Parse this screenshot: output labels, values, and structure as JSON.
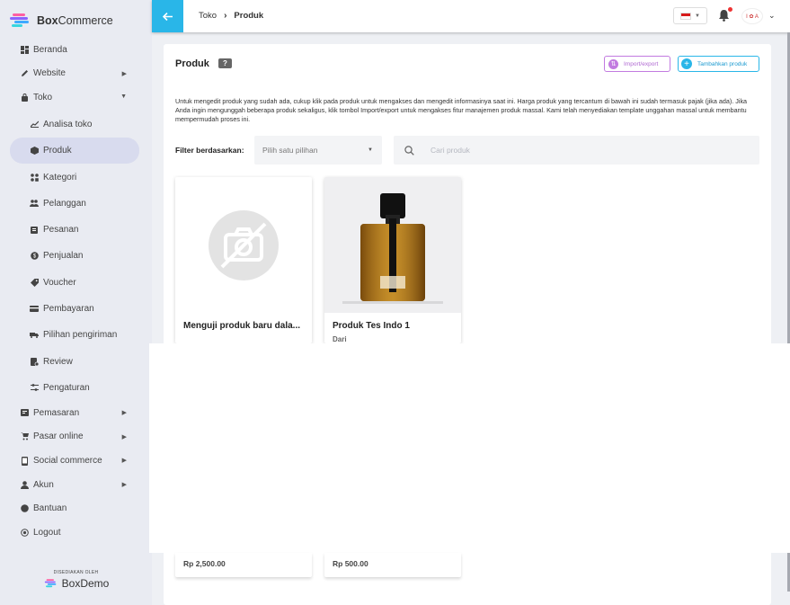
{
  "brand": {
    "name_bold": "Box",
    "name_rest": "Commerce"
  },
  "sidebar": {
    "items": [
      {
        "label": "Beranda",
        "icon": "dashboard-icon"
      },
      {
        "label": "Website",
        "icon": "pencil-icon",
        "expandable": true
      },
      {
        "label": "Toko",
        "icon": "bag-icon",
        "expanded": true
      }
    ],
    "sub_items": [
      {
        "label": "Analisa toko",
        "icon": "chart-icon"
      },
      {
        "label": "Produk",
        "icon": "box-icon",
        "active": true
      },
      {
        "label": "Kategori",
        "icon": "category-icon"
      },
      {
        "label": "Pelanggan",
        "icon": "people-icon"
      },
      {
        "label": "Pesanan",
        "icon": "clipboard-icon"
      },
      {
        "label": "Penjualan",
        "icon": "coin-icon"
      },
      {
        "label": "Voucher",
        "icon": "tag-icon"
      },
      {
        "label": "Pembayaran",
        "icon": "card-icon"
      },
      {
        "label": "Pilihan pengiriman",
        "icon": "truck-icon"
      },
      {
        "label": "Review",
        "icon": "review-icon"
      },
      {
        "label": "Pengaturan",
        "icon": "settings-icon"
      }
    ],
    "bottom_items": [
      {
        "label": "Pemasaran",
        "icon": "megaphone-icon",
        "expandable": true
      },
      {
        "label": "Pasar online",
        "icon": "store-icon",
        "expandable": true
      },
      {
        "label": "Social commerce",
        "icon": "phone-icon",
        "expandable": true
      },
      {
        "label": "Akun",
        "icon": "user-icon",
        "expandable": true
      },
      {
        "label": "Bantuan",
        "icon": "help-icon"
      },
      {
        "label": "Logout",
        "icon": "logout-icon"
      }
    ],
    "footer_small": "DISEDIAKAN OLEH",
    "footer_brand": "BoxDemo"
  },
  "topbar": {
    "breadcrumb_parent": "Toko",
    "breadcrumb_current": "Produk",
    "avatar_text": "I ✿ A"
  },
  "main": {
    "title": "Produk",
    "help_badge": "?",
    "import_label": "Import/export",
    "add_label": "Tambahkan produk",
    "description": "Untuk mengedit produk yang sudah ada, cukup klik pada produk untuk mengakses dan mengedit informasinya saat ini. Harga produk yang tercantum di bawah ini sudah termasuk pajak (jika ada). Jika Anda ingin mengunggah beberapa produk sekaligus, klik tombol Import/export untuk mengakses fitur manajemen produk massal. Kami telah menyediakan template unggahan massal untuk membantu mempermudah proses ini.",
    "filter_label": "Filter berdasarkan:",
    "filter_placeholder": "Pilih satu pilihan",
    "search_placeholder": "Cari produk"
  },
  "products": [
    {
      "name": "Menguji produk baru dala...",
      "from": "",
      "price": "Rp 2,500.00",
      "image": "no-image-icon"
    },
    {
      "name": "Produk Tes Indo 1",
      "from": "Dari",
      "price": "Rp 500.00",
      "image": "perfume-bottle"
    }
  ],
  "colors": {
    "accent": "#29b6e8",
    "import": "#c27be0",
    "sidebar": "#e9ebf2",
    "active": "#d8dbee"
  }
}
